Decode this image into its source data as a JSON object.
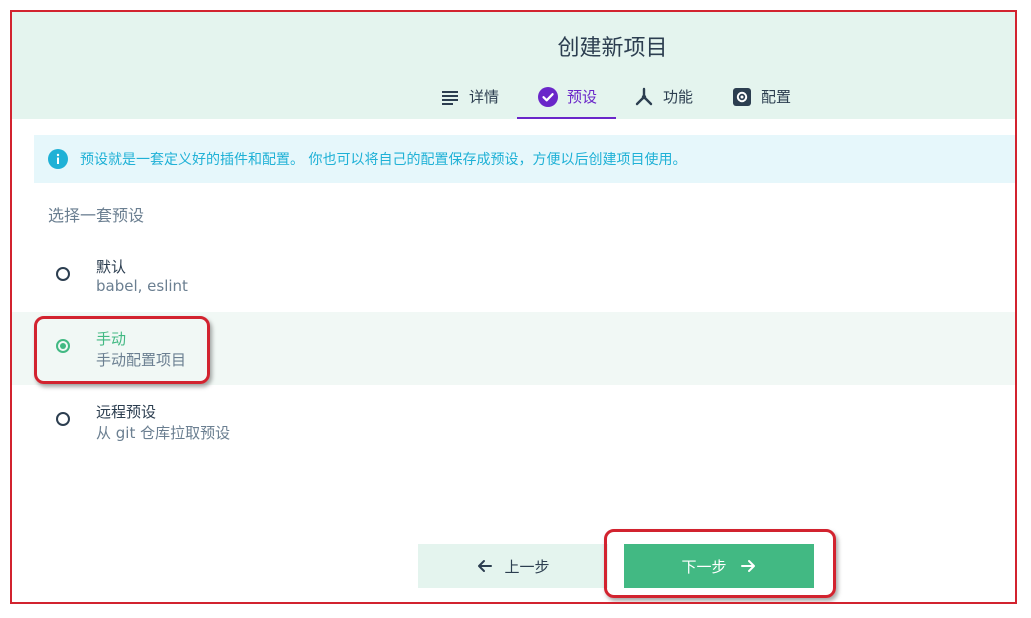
{
  "window": {
    "title": "创建新项目"
  },
  "tabs": [
    {
      "label": "详情",
      "icon": "list-icon",
      "active": false
    },
    {
      "label": "预设",
      "icon": "check-circle-icon",
      "active": true
    },
    {
      "label": "功能",
      "icon": "fork-icon",
      "active": false
    },
    {
      "label": "配置",
      "icon": "settings-icon",
      "active": false
    }
  ],
  "info": {
    "icon": "info-icon",
    "text": "预设就是一套定义好的插件和配置。 你也可以将自己的配置保存成预设，方便以后创建项目使用。"
  },
  "presets": {
    "section_label": "选择一套预设",
    "options": [
      {
        "name": "默认",
        "desc": "babel, eslint",
        "selected": false
      },
      {
        "name": "手动",
        "desc": "手动配置项目",
        "selected": true
      },
      {
        "name": "远程预设",
        "desc": "从 git 仓库拉取预设",
        "selected": false
      }
    ]
  },
  "footer": {
    "prev_label": "上一步",
    "next_label": "下一步"
  },
  "colors": {
    "header_bg": "#e4f4ee",
    "accent_purple": "#6a26c9",
    "accent_green": "#42b983",
    "info_blue": "#1fb1d6",
    "annotation_red": "#d2232f"
  }
}
